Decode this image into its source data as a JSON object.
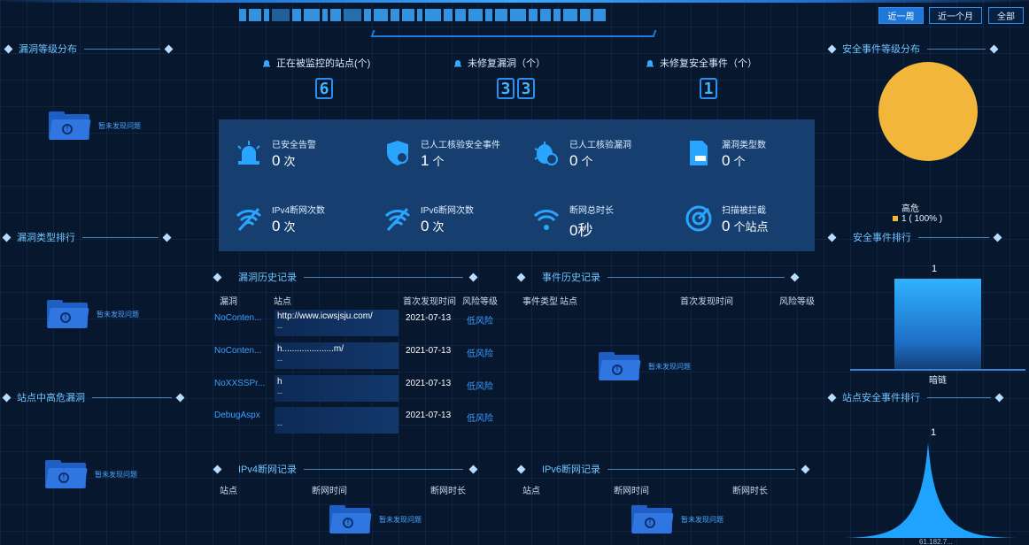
{
  "header": {
    "range_buttons": [
      {
        "label": "近一周",
        "active": true
      },
      {
        "label": "近一个月",
        "active": false
      },
      {
        "label": "全部",
        "active": false
      }
    ]
  },
  "empty_text": "暂未发现问题",
  "sections": {
    "vuln_level": "漏洞等级分布",
    "vuln_type_rank": "漏洞类型排行",
    "site_high_risk": "站点中高危漏洞",
    "event_level": "安全事件等级分布",
    "event_rank": "安全事件排行",
    "site_event_rank": "站点安全事件排行",
    "vuln_history": "漏洞历史记录",
    "event_history": "事件历史记录",
    "ipv4_outage": "IPv4断网记录",
    "ipv6_outage": "IPv6断网记录"
  },
  "counters": [
    {
      "label": "正在被监控的站点(个)",
      "digits": [
        "6"
      ]
    },
    {
      "label": "未修复漏洞（个）",
      "digits": [
        "3",
        "3"
      ]
    },
    {
      "label": "未修复安全事件（个）",
      "digits": [
        "1"
      ]
    }
  ],
  "stats": [
    {
      "label": "已安全告警",
      "value": "0",
      "unit": "次",
      "icon": "alarm-light-icon"
    },
    {
      "label": "已人工核验安全事件",
      "value": "1",
      "unit": "个",
      "icon": "shield-check-icon"
    },
    {
      "label": "已人工核验漏洞",
      "value": "0",
      "unit": "个",
      "icon": "bug-icon"
    },
    {
      "label": "漏洞类型数",
      "value": "0",
      "unit": "个",
      "icon": "document-icon"
    },
    {
      "label": "IPv4断网次数",
      "value": "0",
      "unit": "次",
      "icon": "wifi-off-ipv4-icon"
    },
    {
      "label": "IPv6断网次数",
      "value": "0",
      "unit": "次",
      "icon": "wifi-off-ipv6-icon"
    },
    {
      "label": "断网总时长",
      "value": "0秒",
      "unit": "",
      "icon": "wifi-x-icon"
    },
    {
      "label": "扫描被拦截",
      "value": "0",
      "unit": "个站点",
      "icon": "radar-icon"
    }
  ],
  "vuln_table": {
    "headers": [
      "漏洞",
      "站点",
      "首次发现时间",
      "风险等级"
    ],
    "rows": [
      {
        "vuln": "NoConten...",
        "site": "http://www.icwsjsju.com/",
        "site2": "--",
        "date": "2021-07-13",
        "risk": "低风险"
      },
      {
        "vuln": "NoConten...",
        "site": "h.....................m/",
        "site2": "--",
        "date": "2021-07-13",
        "risk": "低风险"
      },
      {
        "vuln": "NoXXSSPr...",
        "site": "h",
        "site2": "--",
        "date": "2021-07-13",
        "risk": "低风险"
      },
      {
        "vuln": "DebugAspx",
        "site": "",
        "site2": "--",
        "date": "2021-07-13",
        "risk": "低风险"
      }
    ]
  },
  "event_table": {
    "headers": [
      "事件类型",
      "站点",
      "首次发现时间",
      "风险等级"
    ]
  },
  "ipv4_table": {
    "headers": [
      "站点",
      "断网时间",
      "断网时长"
    ]
  },
  "ipv6_table": {
    "headers": [
      "站点",
      "断网时间",
      "断网时长"
    ]
  },
  "chart_data": [
    {
      "type": "pie",
      "title": "安全事件等级分布",
      "categories": [
        "高危"
      ],
      "values": [
        1
      ],
      "legend": [
        "高危"
      ],
      "labels": [
        "1 ( 100% )"
      ],
      "colors": [
        "#f2b63a"
      ]
    },
    {
      "type": "bar",
      "title": "安全事件排行",
      "categories": [
        "暗链"
      ],
      "values": [
        1
      ],
      "colors": [
        "#2fb2ff"
      ]
    },
    {
      "type": "area",
      "title": "站点安全事件排行",
      "categories": [
        "61.182.7..."
      ],
      "values": [
        1
      ],
      "colors": [
        "#1fa3ff"
      ]
    }
  ]
}
